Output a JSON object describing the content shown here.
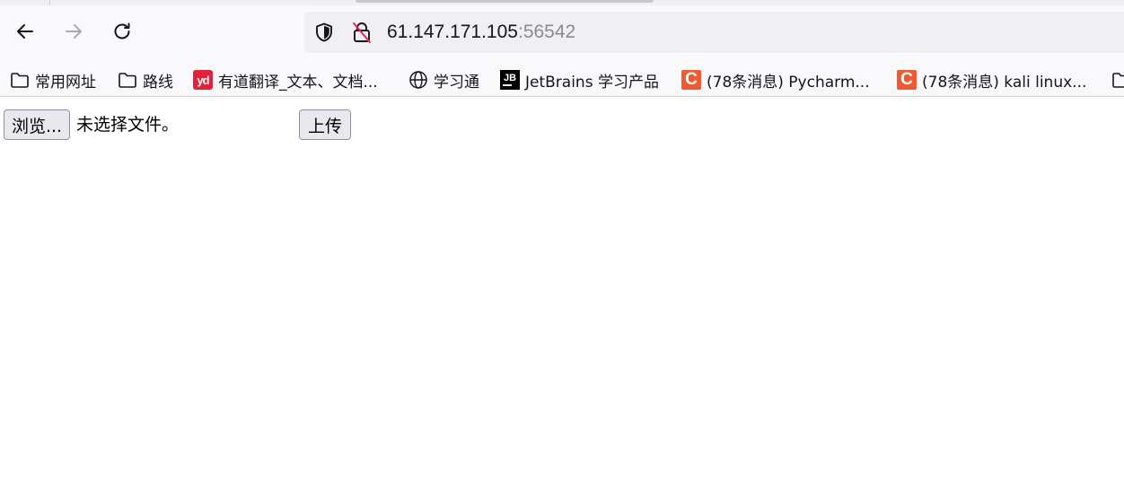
{
  "nav": {
    "back_icon": "back-arrow-icon",
    "forward_icon": "forward-arrow-icon",
    "reload_icon": "reload-icon"
  },
  "url_bar": {
    "host": "61.147.171.105",
    "port": ":56542",
    "shield_icon": "tracking-protection-shield-icon",
    "lock_icon": "insecure-lock-icon"
  },
  "bookmarks": [
    {
      "label": "常用网址",
      "icon": "folder-icon"
    },
    {
      "label": "路线",
      "icon": "folder-icon"
    },
    {
      "label": "有道翻译_文本、文档...",
      "icon": "youdao-icon",
      "favicon_text": "yd"
    },
    {
      "label": "学习通",
      "icon": "globe-icon"
    },
    {
      "label": "JetBrains 学习产品",
      "icon": "jetbrains-icon",
      "favicon_text": "JB"
    },
    {
      "label": "(78条消息) Pycharm...",
      "icon": "csdn-icon",
      "favicon_text": "C"
    },
    {
      "label": "(78条消息) kali linux...",
      "icon": "csdn-icon",
      "favicon_text": "C"
    }
  ],
  "form": {
    "browse_label": "浏览...",
    "no_file_text": "未选择文件。",
    "upload_label": "上传"
  },
  "colors": {
    "chrome_bg": "#f9f9fb",
    "url_bar_bg": "#f0f0f4",
    "youdao": "#e0223a",
    "csdn": "#f05a32"
  }
}
